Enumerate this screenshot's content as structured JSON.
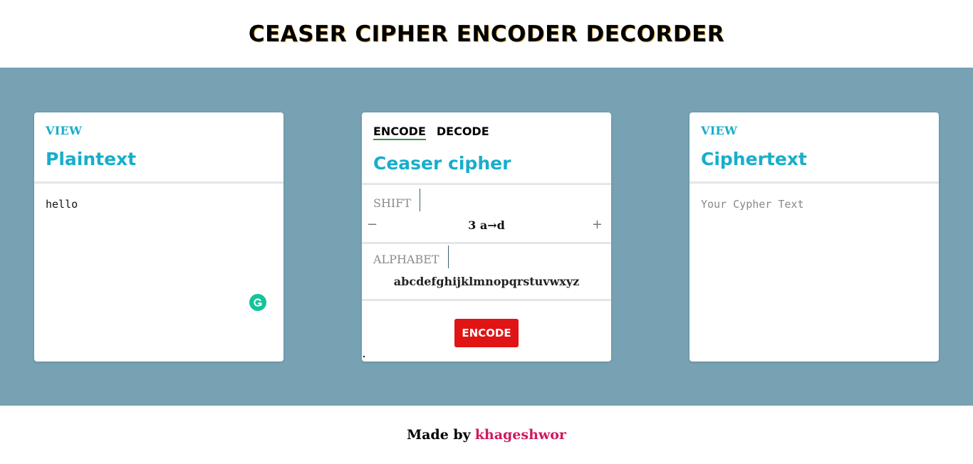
{
  "header": {
    "title": "CEASER CIPHER ENCODER DECORDER"
  },
  "plaintext_card": {
    "view_label": "VIEW",
    "title": "Plaintext",
    "value": "hello"
  },
  "cipher_card": {
    "tabs": [
      {
        "label": "ENCODE",
        "active": true
      },
      {
        "label": "DECODE",
        "active": false
      }
    ],
    "title": "Ceaser cipher",
    "shift_label": "SHIFT",
    "shift_minus": "−",
    "shift_plus": "+",
    "shift_value": "3  a→d",
    "alphabet_label": "ALPHABET",
    "alphabet_value": "abcdefghijklmnopqrstuvwxyz",
    "action_label": "ENCODE"
  },
  "ciphertext_card": {
    "view_label": "VIEW",
    "title": "Ciphertext",
    "placeholder": "Your Cypher Text"
  },
  "footer": {
    "prefix": "Made by",
    "author": "khageshwor"
  },
  "colors": {
    "accent": "#17aecb",
    "stage_bg": "#76a2b3",
    "button_red": "#e01414",
    "author_pink": "#d0195e",
    "grammarly_green": "#15c39a"
  },
  "icons": [
    "grammarly-icon",
    "minus-icon",
    "plus-icon"
  ]
}
